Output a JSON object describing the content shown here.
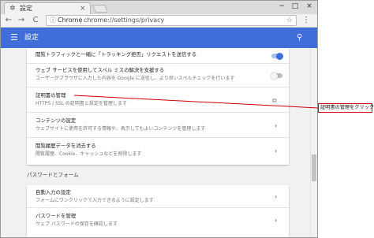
{
  "browser": {
    "tab_title": "設定",
    "tab_close": "×",
    "gear_glyph": "✲",
    "omnibox_brand": "Chrome",
    "omnibox_url": "chrome://settings/privacy",
    "back_glyph": "←",
    "forward_glyph": "→",
    "reload_glyph": "C",
    "star_glyph": "☆",
    "menu_glyph": "⋮",
    "minimize_glyph": "−",
    "maximize_glyph": "□",
    "close_glyph": "×",
    "secure_glyph": "ⓘ"
  },
  "appbar": {
    "title": "設定",
    "menu_glyph": "☰",
    "search_glyph": "⚲",
    "color": "#3f6ed9"
  },
  "privacy_items": [
    {
      "title": "閲覧トラフィックと一緒に「トラッキング拒否」リクエストを送信する",
      "subtitle": "",
      "control": "toggle",
      "on": true
    },
    {
      "title": "ウェブ サービスを使用してスペル ミスの解決を支援する",
      "subtitle": "ユーザーがブラウザに入力した内容を Google に送信し、より良いスペルチェックを行います",
      "control": "toggle",
      "on": false
    },
    {
      "title": "証明書の管理",
      "subtitle": "HTTPS / SSL の証明書と設定を管理します",
      "control": "external"
    },
    {
      "title": "コンテンツの設定",
      "subtitle": "ウェブサイトに使用を許可する情報や、表示してもよいコンテンツを管理します",
      "control": "chevron"
    },
    {
      "title": "閲覧履歴データを消去する",
      "subtitle": "閲覧履歴、Cookie、キャッシュなどを削除します",
      "control": "chevron"
    }
  ],
  "passwords_section": {
    "label": "パスワードとフォーム",
    "items": [
      {
        "title": "自動入力の設定",
        "subtitle": "フォームにワンクリックで入力できるように設定します",
        "control": "chevron"
      },
      {
        "title": "パスワードを管理",
        "subtitle": "ウェブ パスワードの保存を確認します",
        "control": "chevron"
      }
    ]
  },
  "icons": {
    "chevron_glyph": "›",
    "external_glyph": "⧉"
  },
  "colors": {
    "toggle_on_track": "#a7bff0",
    "toggle_on_knob": "#3f6ed9",
    "toggle_off_track": "#bdbdbd",
    "toggle_off_knob": "#f5f5f5",
    "callout_red": "#cc0000"
  },
  "callout": {
    "text": "証明書の管理をクリック"
  }
}
